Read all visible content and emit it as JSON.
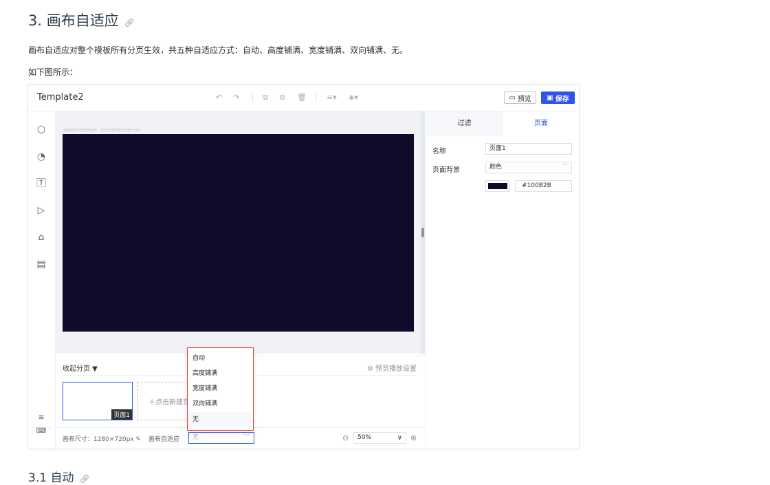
{
  "doc": {
    "heading": "3. 画布自适应",
    "heading_link_icon": "link-icon",
    "para1": "画布自适应对整个模板所有分页生效，共五种自适应方式：自动、高度铺满、宽度铺满、双向铺满、无。",
    "para2": "如下图所示：",
    "subheading": "3.1 自动",
    "subheading_link_icon": "link-icon"
  },
  "editor": {
    "title": "Template2",
    "toolbar_icons": [
      "undo-icon",
      "redo-icon",
      "copy-icon",
      "paste-icon",
      "delete-icon",
      "align-icon",
      "layer-icon"
    ],
    "preview_label": "预览",
    "save_label": "保存",
    "left_icons": [
      "cube-icon",
      "chart-icon",
      "text-icon",
      "video-icon",
      "inbox-icon",
      "table-icon",
      "layers-icon",
      "keyboard-icon"
    ],
    "canvas_hint": "请拖拽组件放置到画布，或双击组件自动放置于画布",
    "canvas_color": "#100B2B",
    "pages": {
      "collapse_label": "收起分页 ▼",
      "play_settings_label": "⚙ 预览播放设置",
      "page1_label": "页面1",
      "new_page_label": "＋点击新建页面"
    },
    "status": {
      "size_label": "画布尺寸：1280×720px",
      "fit_label": "画布自适应",
      "fit_value": "无",
      "zoom_value": "50%"
    },
    "right_panel": {
      "tab_filter": "过滤",
      "tab_page": "页面",
      "name_label": "名称",
      "name_value": "页面1",
      "bg_label": "页面背景",
      "bg_type_value": "颜色",
      "bg_hex_value": "#100B2B"
    },
    "dropdown_options": [
      "自动",
      "高度铺满",
      "宽度铺满",
      "双向铺满",
      "无"
    ]
  },
  "colors": {
    "accent": "#2f54eb",
    "highlight_border": "#e23434",
    "canvas": "#100b2b"
  }
}
